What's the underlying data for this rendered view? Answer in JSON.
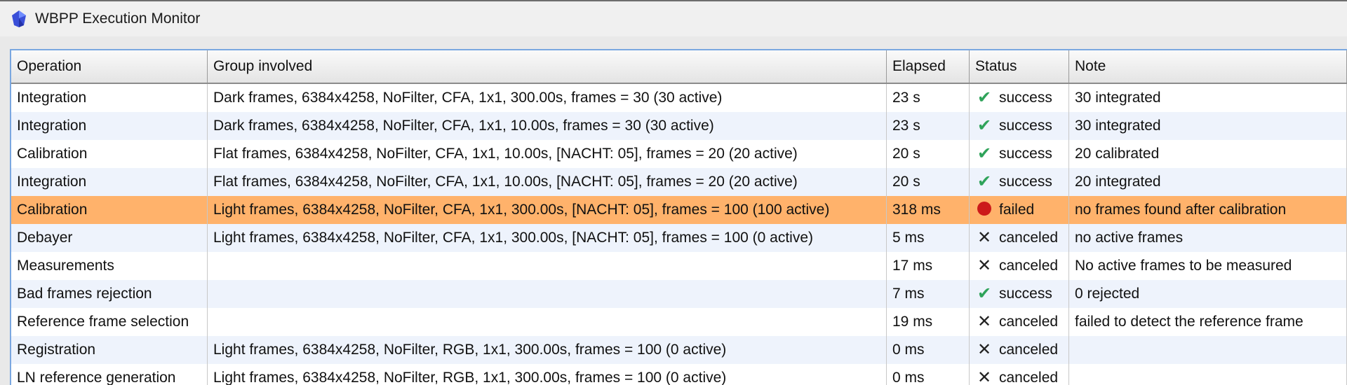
{
  "window": {
    "title": "WBPP Execution Monitor"
  },
  "table": {
    "columns": [
      "Operation",
      "Group involved",
      "Elapsed",
      "Status",
      "Note"
    ],
    "rows": [
      {
        "operation": "Integration",
        "group": "Dark frames, 6384x4258, NoFilter, CFA, 1x1, 300.00s, frames = 30 (30 active)",
        "elapsed": "23 s",
        "status": "success",
        "status_icon": "check-icon",
        "note": "30 integrated",
        "selected": false
      },
      {
        "operation": "Integration",
        "group": "Dark frames, 6384x4258, NoFilter, CFA, 1x1, 10.00s, frames = 30 (30 active)",
        "elapsed": "23 s",
        "status": "success",
        "status_icon": "check-icon",
        "note": "30 integrated",
        "selected": false
      },
      {
        "operation": "Calibration",
        "group": "Flat frames, 6384x4258, NoFilter, CFA, 1x1, 10.00s, [NACHT: 05], frames = 20 (20 active)",
        "elapsed": "20 s",
        "status": "success",
        "status_icon": "check-icon",
        "note": "20 calibrated",
        "selected": false
      },
      {
        "operation": "Integration",
        "group": "Flat frames, 6384x4258, NoFilter, CFA, 1x1, 10.00s, [NACHT: 05], frames = 20 (20 active)",
        "elapsed": "20 s",
        "status": "success",
        "status_icon": "check-icon",
        "note": "20 integrated",
        "selected": false
      },
      {
        "operation": "Calibration",
        "group": "Light frames, 6384x4258, NoFilter, CFA, 1x1, 300.00s, [NACHT: 05], frames = 100 (100 active)",
        "elapsed": "318 ms",
        "status": "failed",
        "status_icon": "red-dot-icon",
        "note": "no frames found after calibration",
        "selected": true
      },
      {
        "operation": "Debayer",
        "group": "Light frames, 6384x4258, NoFilter, CFA, 1x1, 300.00s, [NACHT: 05], frames = 100 (0 active)",
        "elapsed": "5 ms",
        "status": "canceled",
        "status_icon": "x-icon",
        "note": "no active frames",
        "selected": false
      },
      {
        "operation": "Measurements",
        "group": "",
        "elapsed": "17 ms",
        "status": "canceled",
        "status_icon": "x-icon",
        "note": "No active frames to be measured",
        "selected": false
      },
      {
        "operation": "Bad frames rejection",
        "group": "",
        "elapsed": "7 ms",
        "status": "success",
        "status_icon": "check-icon",
        "note": "0 rejected",
        "selected": false
      },
      {
        "operation": "Reference frame selection",
        "group": "",
        "elapsed": "19 ms",
        "status": "canceled",
        "status_icon": "x-icon",
        "note": "failed to detect the reference frame",
        "selected": false
      },
      {
        "operation": "Registration",
        "group": "Light frames, 6384x4258, NoFilter, RGB, 1x1, 300.00s, frames = 100 (0 active)",
        "elapsed": "0 ms",
        "status": "canceled",
        "status_icon": "x-icon",
        "note": "",
        "selected": false
      },
      {
        "operation": "LN reference generation",
        "group": "Light frames, 6384x4258, NoFilter, RGB, 1x1, 300.00s, frames = 100 (0 active)",
        "elapsed": "0 ms",
        "status": "canceled",
        "status_icon": "x-icon",
        "note": "",
        "selected": false
      }
    ]
  },
  "colors": {
    "selected_row": "#ffb26b",
    "alt_row": "#eef3fc",
    "success": "#2fa35a",
    "failed": "#cc1a1a",
    "frame_border": "#7aa7e0"
  }
}
